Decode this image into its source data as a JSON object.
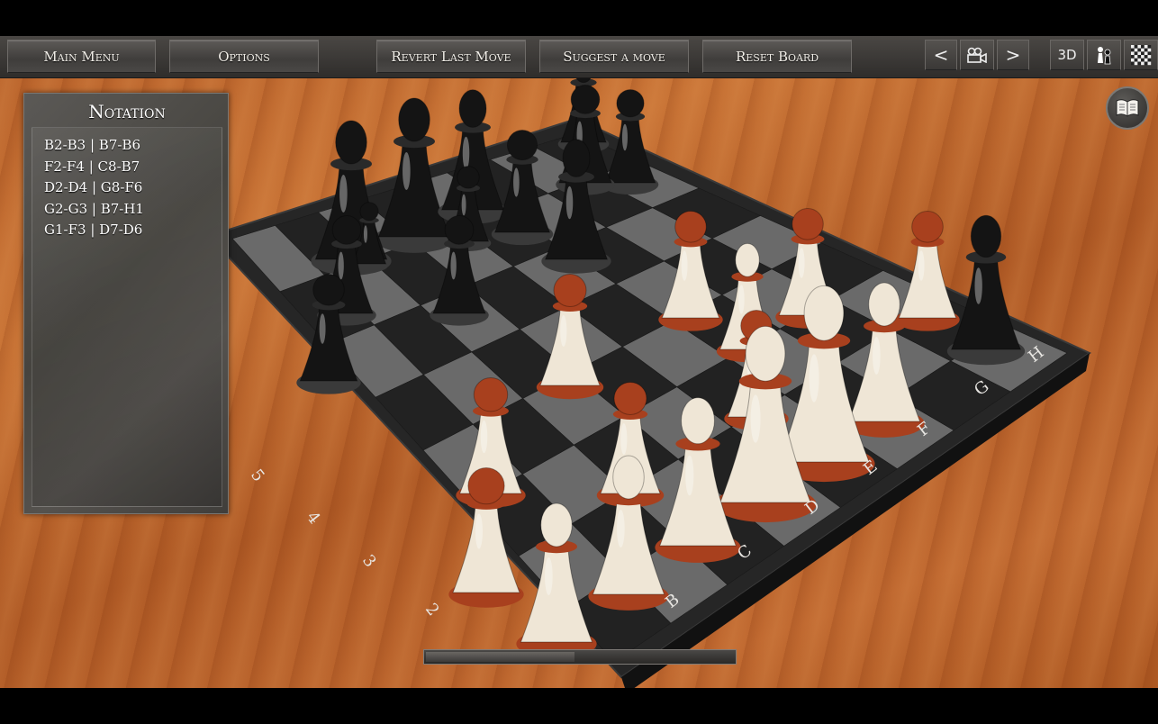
{
  "toolbar": {
    "main_menu": "Main Menu",
    "options": "Options",
    "revert": "Revert Last Move",
    "suggest": "Suggest a move",
    "reset": "Reset Board",
    "prev_symbol": "<",
    "next_symbol": ">",
    "mode_3d": "3D"
  },
  "notation": {
    "title": "Notation",
    "moves": [
      "B2-B3 | B7-B6",
      "F2-F4 | C8-B7",
      "D2-D4 | G8-F6",
      "G2-G3 | B7-H1",
      "G1-F3 | D7-D6"
    ]
  },
  "board": {
    "files": [
      "B",
      "C",
      "D",
      "E",
      "F",
      "G",
      "H"
    ],
    "ranks": [
      "2",
      "3",
      "4",
      "5"
    ]
  },
  "progress": {
    "value": 0.48
  },
  "colors": {
    "table_wood": "#c06a31",
    "toolbar": "#3c3a38",
    "board_frame": "#2a2a2a",
    "light_square": "#6a6a6a",
    "dark_square": "#222222",
    "white_piece": "#efe6d6",
    "white_piece_accent": "#a8401e",
    "black_piece": "#141414"
  },
  "icons": {
    "camera": "movie-camera-icon",
    "piece_view": "chess-pieces-icon",
    "flat_view": "checkerboard-icon",
    "notation_toggle": "open-book-icon"
  }
}
